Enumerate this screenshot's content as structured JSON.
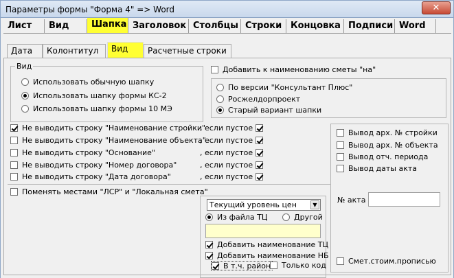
{
  "window": {
    "title": "Параметры формы \"Форма 4\" => Word",
    "close": "✕"
  },
  "main_tabs": [
    "Лист",
    "Вид",
    "Шапка",
    "Заголовок",
    "Столбцы",
    "Строки",
    "Концовка",
    "Подписи",
    "Word"
  ],
  "sub_tabs": [
    "Дата",
    "Колонтитул",
    "Вид",
    "Расчетные строки"
  ],
  "vid_group": {
    "legend": "Вид",
    "options": [
      "Использовать обычную шапку",
      "Использовать шапку формы КС-2",
      "Использовать шапку формы 10 МЭ"
    ],
    "selected": 1
  },
  "add_name": {
    "label": "Добавить к наименованию сметы \"на\"",
    "checked": false
  },
  "version_group": {
    "options": [
      "По версии \"Консультант Плюс\"",
      "Росжелдорпроект",
      "Старый вариант шапки"
    ],
    "selected": 2
  },
  "hide_rows": {
    "if_empty": ", если пустое",
    "items": [
      {
        "label": "Не выводить строку \"Наименование стройки\"",
        "checked": true,
        "empty_checked": true
      },
      {
        "label": "Не выводить строку \"Наименование объекта\"",
        "checked": false,
        "empty_checked": true
      },
      {
        "label": "Не выводить строку \"Основание\"",
        "checked": false,
        "empty_checked": true
      },
      {
        "label": "Не выводить строку \"Номер договора\"",
        "checked": false,
        "empty_checked": true
      },
      {
        "label": "Не выводить строку \"Дата договора\"",
        "checked": false,
        "empty_checked": true
      }
    ]
  },
  "swap": {
    "label": "Поменять местами \"ЛСР\" и \"Локальная смета\"",
    "checked": false
  },
  "price": {
    "select_value": "Текущий уровень цен",
    "from_file": "Из файла ТЦ",
    "other": "Другой",
    "source_selected": 0,
    "add_tc": {
      "label": "Добавить наименование ТЦ",
      "checked": true
    },
    "add_nb": {
      "label": "Добавить наименование НБ",
      "checked": true
    },
    "incl_region": {
      "label": "В т.ч. район",
      "checked": true
    },
    "code_only": {
      "label": "Только код",
      "checked": false
    }
  },
  "right_group": {
    "items": [
      {
        "label": "Вывод арх. № стройки",
        "checked": false
      },
      {
        "label": "Вывод арх. № объекта",
        "checked": false
      },
      {
        "label": "Вывод отч. периода",
        "checked": false
      },
      {
        "label": "Вывод даты акта",
        "checked": false
      }
    ],
    "act_no_label": "№ акта",
    "act_no_value": "",
    "cost_words": {
      "label": "Смет.стоим.прописью",
      "checked": false
    }
  }
}
